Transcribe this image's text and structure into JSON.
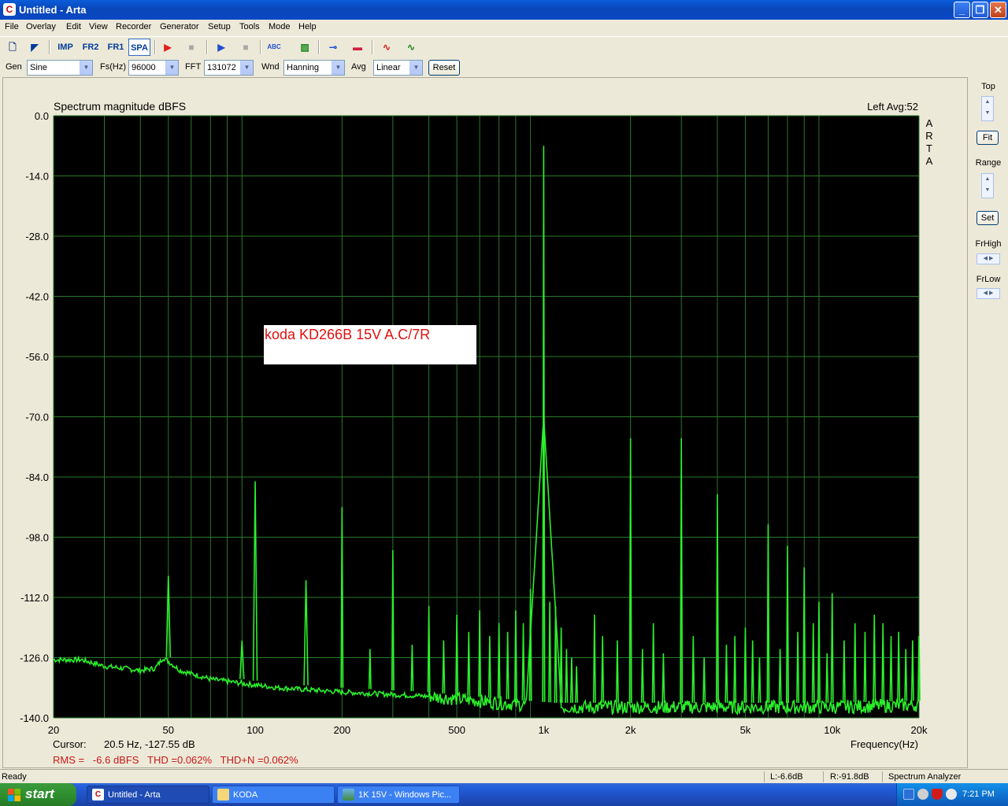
{
  "window": {
    "title": "Untitled - Arta",
    "app_icon": "C",
    "minimize": "_",
    "maximize": "❐",
    "close": "✕"
  },
  "menu": [
    "File",
    "Overlay",
    "Edit",
    "View",
    "Recorder",
    "Generator",
    "Setup",
    "Tools",
    "Mode",
    "Help"
  ],
  "toolbar": {
    "buttons": [
      {
        "name": "new-file-icon",
        "label": "🗋"
      },
      {
        "name": "open-file-icon",
        "label": "◤"
      },
      {
        "name": "imp-mode-button",
        "label": "IMP"
      },
      {
        "name": "fr2-mode-button",
        "label": "FR2"
      },
      {
        "name": "fr1-mode-button",
        "label": "FR1"
      },
      {
        "name": "spa-mode-button",
        "label": "SPA"
      },
      {
        "name": "record-icon",
        "label": "▶"
      },
      {
        "name": "stop-record-icon",
        "label": "■"
      },
      {
        "name": "play-icon",
        "label": "▶"
      },
      {
        "name": "stop-play-icon",
        "label": "■"
      },
      {
        "name": "abc-icon",
        "label": "ABC"
      },
      {
        "name": "overlay-icon",
        "label": "▨"
      },
      {
        "name": "probe-icon",
        "label": "⊸"
      },
      {
        "name": "sweep-icon",
        "label": "▬"
      },
      {
        "name": "scope-icon",
        "label": "∿"
      },
      {
        "name": "wave-icon",
        "label": "∿"
      }
    ]
  },
  "params": {
    "gen_label": "Gen",
    "gen_value": "Sine",
    "fs_label": "Fs(Hz)",
    "fs_value": "96000",
    "fft_label": "FFT",
    "fft_value": "131072",
    "wnd_label": "Wnd",
    "wnd_value": "Hanning",
    "avg_label": "Avg",
    "avg_value": "Linear",
    "reset_label": "Reset"
  },
  "right_panel": {
    "top_label": "Top",
    "fit_label": "Fit",
    "range_label": "Range",
    "set_label": "Set",
    "frhigh_label": "FrHigh",
    "frlow_label": "FrLow"
  },
  "plot": {
    "title": "Spectrum magnitude dBFS",
    "channel": "Left  Avg:52",
    "watermark": [
      "A",
      "R",
      "T",
      "A"
    ],
    "annotation": "koda KD266B 15V A.C/7R",
    "cursor_label": "Cursor:",
    "cursor_value": "20.5 Hz, -127.55 dB",
    "rms_line": "RMS =   -6.6 dBFS   THD =0.062%   THD+N =0.062%",
    "xlabel": "Frequency(Hz)",
    "colors": {
      "background": "#000000",
      "grid": "#2a7a2a",
      "trace": "#2bf02b",
      "annotation": "#e01010",
      "rms": "#c81818"
    }
  },
  "chart_data": {
    "type": "line",
    "title": "Spectrum magnitude dBFS",
    "xlabel": "Frequency(Hz)",
    "ylabel": "",
    "x_scale": "log",
    "xlim": [
      20,
      20000
    ],
    "ylim": [
      -140,
      0
    ],
    "y_ticks": [
      "0.0",
      "-14.0",
      "-28.0",
      "-42.0",
      "-56.0",
      "-70.0",
      "-84.0",
      "-98.0",
      "-112.0",
      "-126.0",
      "-140.0"
    ],
    "x_ticks": [
      {
        "value": 20,
        "label": "20"
      },
      {
        "value": 50,
        "label": "50"
      },
      {
        "value": 100,
        "label": "100"
      },
      {
        "value": 200,
        "label": "200"
      },
      {
        "value": 500,
        "label": "500"
      },
      {
        "value": 1000,
        "label": "1k"
      },
      {
        "value": 2000,
        "label": "2k"
      },
      {
        "value": 5000,
        "label": "5k"
      },
      {
        "value": 10000,
        "label": "10k"
      },
      {
        "value": 20000,
        "label": "20k"
      }
    ],
    "grid": true,
    "noise_floor": [
      [
        20,
        -126.5
      ],
      [
        25,
        -126.5
      ],
      [
        30,
        -128
      ],
      [
        35,
        -128.5
      ],
      [
        40,
        -129
      ],
      [
        45,
        -128.5
      ],
      [
        48,
        -126
      ],
      [
        55,
        -129
      ],
      [
        70,
        -131
      ],
      [
        90,
        -132
      ],
      [
        120,
        -133
      ],
      [
        200,
        -134
      ],
      [
        400,
        -135
      ],
      [
        700,
        -136.5
      ],
      [
        1100,
        -137.5
      ],
      [
        2000,
        -137.5
      ],
      [
        5000,
        -137.5
      ],
      [
        10000,
        -137.5
      ],
      [
        20000,
        -137
      ]
    ],
    "peaks": [
      {
        "f": 50,
        "db": -107
      },
      {
        "f": 90,
        "db": -122
      },
      {
        "f": 100,
        "db": -85
      },
      {
        "f": 150,
        "db": -108
      },
      {
        "f": 200,
        "db": -91
      },
      {
        "f": 250,
        "db": -124
      },
      {
        "f": 300,
        "db": -101
      },
      {
        "f": 350,
        "db": -123
      },
      {
        "f": 400,
        "db": -114
      },
      {
        "f": 450,
        "db": -122
      },
      {
        "f": 500,
        "db": -116
      },
      {
        "f": 550,
        "db": -120
      },
      {
        "f": 600,
        "db": -115
      },
      {
        "f": 650,
        "db": -121
      },
      {
        "f": 700,
        "db": -118
      },
      {
        "f": 750,
        "db": -120
      },
      {
        "f": 800,
        "db": -115
      },
      {
        "f": 850,
        "db": -118
      },
      {
        "f": 900,
        "db": -110
      },
      {
        "f": 1000,
        "db": -7
      },
      {
        "f": 1000,
        "db": -55
      },
      {
        "f": 1050,
        "db": -113
      },
      {
        "f": 1100,
        "db": -114
      },
      {
        "f": 1150,
        "db": -119
      },
      {
        "f": 1200,
        "db": -124
      },
      {
        "f": 1250,
        "db": -126
      },
      {
        "f": 1300,
        "db": -128
      },
      {
        "f": 1500,
        "db": -116
      },
      {
        "f": 1600,
        "db": -121
      },
      {
        "f": 1800,
        "db": -122
      },
      {
        "f": 2000,
        "db": -75
      },
      {
        "f": 2200,
        "db": -124
      },
      {
        "f": 2400,
        "db": -118
      },
      {
        "f": 2600,
        "db": -125
      },
      {
        "f": 3000,
        "db": -75
      },
      {
        "f": 3300,
        "db": -121
      },
      {
        "f": 3600,
        "db": -126
      },
      {
        "f": 4000,
        "db": -88
      },
      {
        "f": 4300,
        "db": -123
      },
      {
        "f": 4600,
        "db": -121
      },
      {
        "f": 5000,
        "db": -119
      },
      {
        "f": 5300,
        "db": -122
      },
      {
        "f": 5600,
        "db": -126
      },
      {
        "f": 6000,
        "db": -95
      },
      {
        "f": 6600,
        "db": -124
      },
      {
        "f": 7000,
        "db": -100
      },
      {
        "f": 7600,
        "db": -120
      },
      {
        "f": 8000,
        "db": -105
      },
      {
        "f": 8600,
        "db": -118
      },
      {
        "f": 9000,
        "db": -113
      },
      {
        "f": 9600,
        "db": -125
      },
      {
        "f": 10000,
        "db": -111
      },
      {
        "f": 11000,
        "db": -122
      },
      {
        "f": 12000,
        "db": -118
      },
      {
        "f": 13000,
        "db": -120
      },
      {
        "f": 14000,
        "db": -116
      },
      {
        "f": 15000,
        "db": -118
      },
      {
        "f": 16000,
        "db": -121
      },
      {
        "f": 17000,
        "db": -120
      },
      {
        "f": 18000,
        "db": -124
      },
      {
        "f": 19000,
        "db": -122
      },
      {
        "f": 20000,
        "db": -121
      }
    ]
  },
  "status": {
    "ready": "Ready",
    "left_level": "L:-6.6dB",
    "right_level": "R:-91.8dB",
    "mode": "Spectrum Analyzer"
  },
  "taskbar": {
    "start": "start",
    "tasks": [
      {
        "label": "Untitled - Arta",
        "icon": "arta-icon",
        "active": true
      },
      {
        "label": "KODA",
        "icon": "folder-icon",
        "active": false
      },
      {
        "label": "1K 15V - Windows Pic...",
        "icon": "picture-viewer-icon",
        "active": false
      }
    ],
    "clock": "7:21 PM"
  }
}
